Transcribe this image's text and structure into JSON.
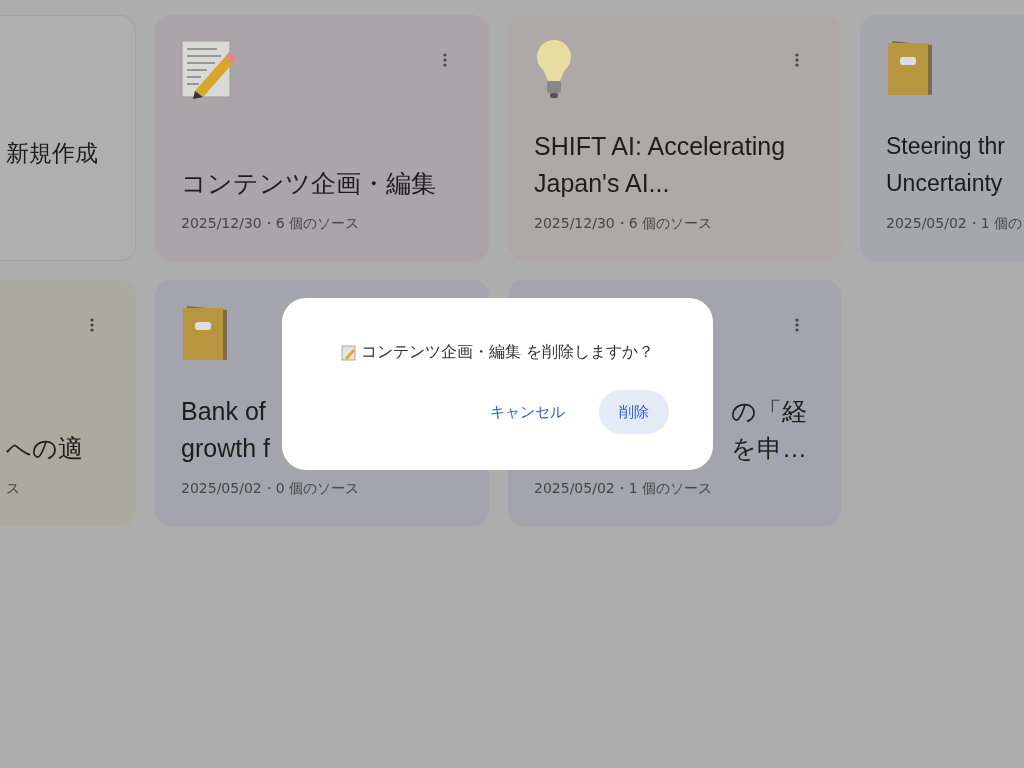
{
  "cards": [
    {
      "kind": "create",
      "color": "#afafaf",
      "title_lines": [
        "新規作成"
      ],
      "menu": false
    },
    {
      "kind": "memo",
      "color": "#aba4a9",
      "title_lines": [
        "コンテンツ企画・編集"
      ],
      "meta": "2025/12/30・6 個のソース",
      "menu": true
    },
    {
      "kind": "bulb",
      "color": "#aea8a6",
      "title_lines": [
        "SHIFT AI: Accelerating",
        "Japan's AI..."
      ],
      "meta": "2025/12/30・6 個のソース",
      "menu": true
    },
    {
      "kind": "book",
      "color": "#a5a6ae",
      "title_lines": [
        "Steering thr",
        "Uncertainty"
      ],
      "meta": "2025/05/02・1 個の",
      "menu": false
    },
    {
      "kind": "plain",
      "color": "#aaaa9f",
      "title_lines": [
        "への適"
      ],
      "meta": "ス",
      "menu": true
    },
    {
      "kind": "book",
      "color": "#a3a4ad",
      "title_lines": [
        "Bank of",
        "growth f"
      ],
      "meta": "2025/05/02・0 個のソース",
      "menu": false
    },
    {
      "kind": "right",
      "color": "#a3a4ad",
      "title_lines": [
        "の「経",
        "を申…"
      ],
      "meta": "2025/05/02・1 個のソース",
      "menu": true
    }
  ],
  "dialog": {
    "message": "コンテンツ企画・編集 を削除しますか？",
    "buttons": [
      {
        "label": "キャンセル",
        "kind": "text"
      },
      {
        "label": "削除",
        "kind": "tonal"
      }
    ]
  }
}
